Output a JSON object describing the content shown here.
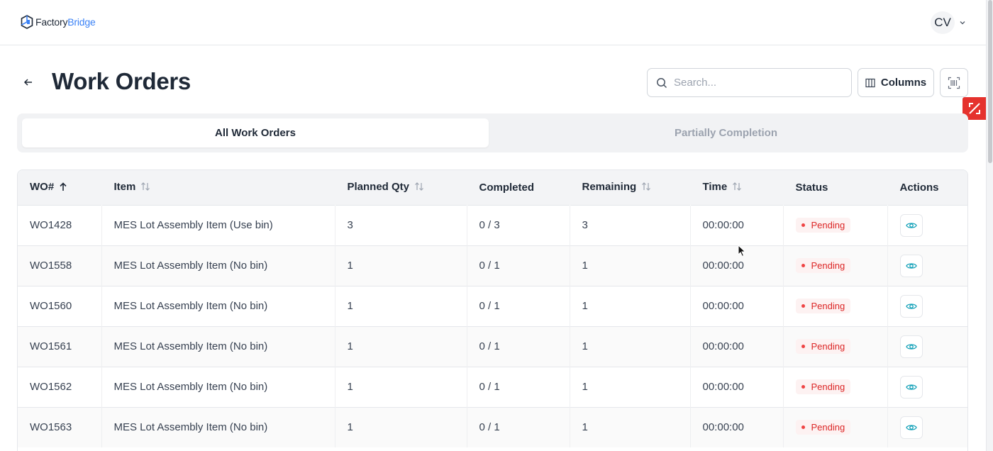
{
  "brand": {
    "name_part1": "Factory",
    "name_part2": "Bridge",
    "accent_color": "#3b82f6"
  },
  "user": {
    "initials": "CV"
  },
  "page": {
    "title": "Work Orders"
  },
  "search": {
    "placeholder": "Search..."
  },
  "toolbar": {
    "columns_label": "Columns"
  },
  "tabs": [
    {
      "label": "All Work Orders",
      "active": true
    },
    {
      "label": "Partially Completion",
      "active": false
    }
  ],
  "table": {
    "headers": {
      "wo": "WO#",
      "item": "Item",
      "planned_qty": "Planned Qty",
      "completed": "Completed",
      "remaining": "Remaining",
      "time": "Time",
      "status": "Status",
      "actions": "Actions"
    },
    "rows": [
      {
        "wo": "WO1428",
        "item": "MES Lot Assembly Item (Use bin)",
        "planned_qty": "3",
        "completed": "0 / 3",
        "remaining": "3",
        "time": "00:00:00",
        "status": "Pending"
      },
      {
        "wo": "WO1558",
        "item": "MES Lot Assembly Item (No bin)",
        "planned_qty": "1",
        "completed": "0 / 1",
        "remaining": "1",
        "time": "00:00:00",
        "status": "Pending"
      },
      {
        "wo": "WO1560",
        "item": "MES Lot Assembly Item (No bin)",
        "planned_qty": "1",
        "completed": "0 / 1",
        "remaining": "1",
        "time": "00:00:00",
        "status": "Pending"
      },
      {
        "wo": "WO1561",
        "item": "MES Lot Assembly Item (No bin)",
        "planned_qty": "1",
        "completed": "0 / 1",
        "remaining": "1",
        "time": "00:00:00",
        "status": "Pending"
      },
      {
        "wo": "WO1562",
        "item": "MES Lot Assembly Item (No bin)",
        "planned_qty": "1",
        "completed": "0 / 1",
        "remaining": "1",
        "time": "00:00:00",
        "status": "Pending"
      },
      {
        "wo": "WO1563",
        "item": "MES Lot Assembly Item (No bin)",
        "planned_qty": "1",
        "completed": "0 / 1",
        "remaining": "1",
        "time": "00:00:00",
        "status": "Pending"
      }
    ]
  },
  "colors": {
    "status_pending": "#dc2626",
    "fab_red": "#e5322d"
  },
  "icons": [
    "logo-icon",
    "chevron-down-icon",
    "back-arrow-icon",
    "search-icon",
    "columns-icon",
    "barcode-scan-icon",
    "resize-icon",
    "sort-asc-icon",
    "sort-icon",
    "eye-icon",
    "cursor-icon"
  ]
}
